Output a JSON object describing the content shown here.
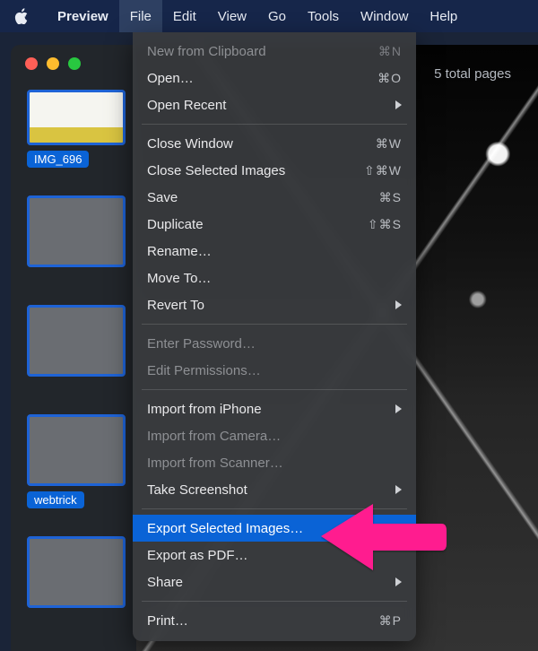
{
  "menubar": {
    "app": "Preview",
    "items": [
      "File",
      "Edit",
      "View",
      "Go",
      "Tools",
      "Window",
      "Help"
    ],
    "active_index": 0
  },
  "window": {
    "toolbar_right": "5 total pages",
    "thumbnails": [
      {
        "label": "IMG_696"
      },
      {
        "label": ""
      },
      {
        "label": ""
      },
      {
        "label": "webtrick"
      },
      {
        "label": ""
      }
    ]
  },
  "menu": {
    "groups": [
      [
        {
          "label": "New from Clipboard",
          "shortcut": "⌘N",
          "enabled": false
        },
        {
          "label": "Open…",
          "shortcut": "⌘O",
          "enabled": true
        },
        {
          "label": "Open Recent",
          "submenu": true,
          "enabled": true
        }
      ],
      [
        {
          "label": "Close Window",
          "shortcut": "⌘W",
          "enabled": true
        },
        {
          "label": "Close Selected Images",
          "shortcut": "⇧⌘W",
          "enabled": true
        },
        {
          "label": "Save",
          "shortcut": "⌘S",
          "enabled": true
        },
        {
          "label": "Duplicate",
          "shortcut": "⇧⌘S",
          "enabled": true
        },
        {
          "label": "Rename…",
          "enabled": true
        },
        {
          "label": "Move To…",
          "enabled": true
        },
        {
          "label": "Revert To",
          "submenu": true,
          "enabled": true
        }
      ],
      [
        {
          "label": "Enter Password…",
          "enabled": false
        },
        {
          "label": "Edit Permissions…",
          "enabled": false
        }
      ],
      [
        {
          "label": "Import from iPhone",
          "submenu": true,
          "enabled": true
        },
        {
          "label": "Import from Camera…",
          "enabled": false
        },
        {
          "label": "Import from Scanner…",
          "enabled": false
        },
        {
          "label": "Take Screenshot",
          "submenu": true,
          "enabled": true
        }
      ],
      [
        {
          "label": "Export Selected Images…",
          "enabled": true,
          "highlight": true
        },
        {
          "label": "Export as PDF…",
          "enabled": true
        },
        {
          "label": "Share",
          "submenu": true,
          "enabled": true
        }
      ],
      [
        {
          "label": "Print…",
          "shortcut": "⌘P",
          "enabled": true
        }
      ]
    ]
  }
}
